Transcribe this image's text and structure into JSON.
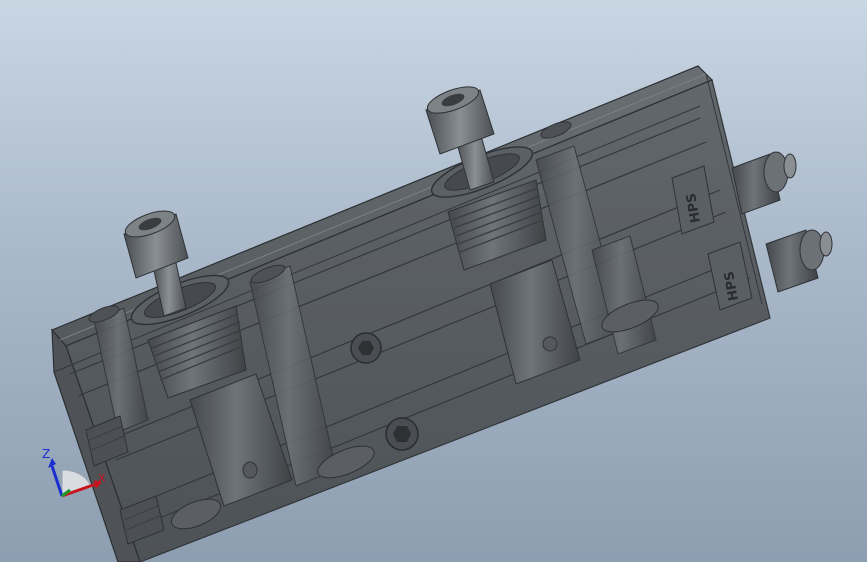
{
  "viewport": {
    "background_top": "#c9d6e3",
    "background_bottom": "#8d9eb1"
  },
  "model": {
    "body_color": "#555a5e",
    "edge_color": "#2c2f32",
    "engraving_text": "HPS"
  },
  "triad": {
    "z_label": "Z",
    "x_label": "X",
    "z_color": "#1b2fd1",
    "x_color": "#c8141e",
    "y_color": "#1c9a2a"
  }
}
